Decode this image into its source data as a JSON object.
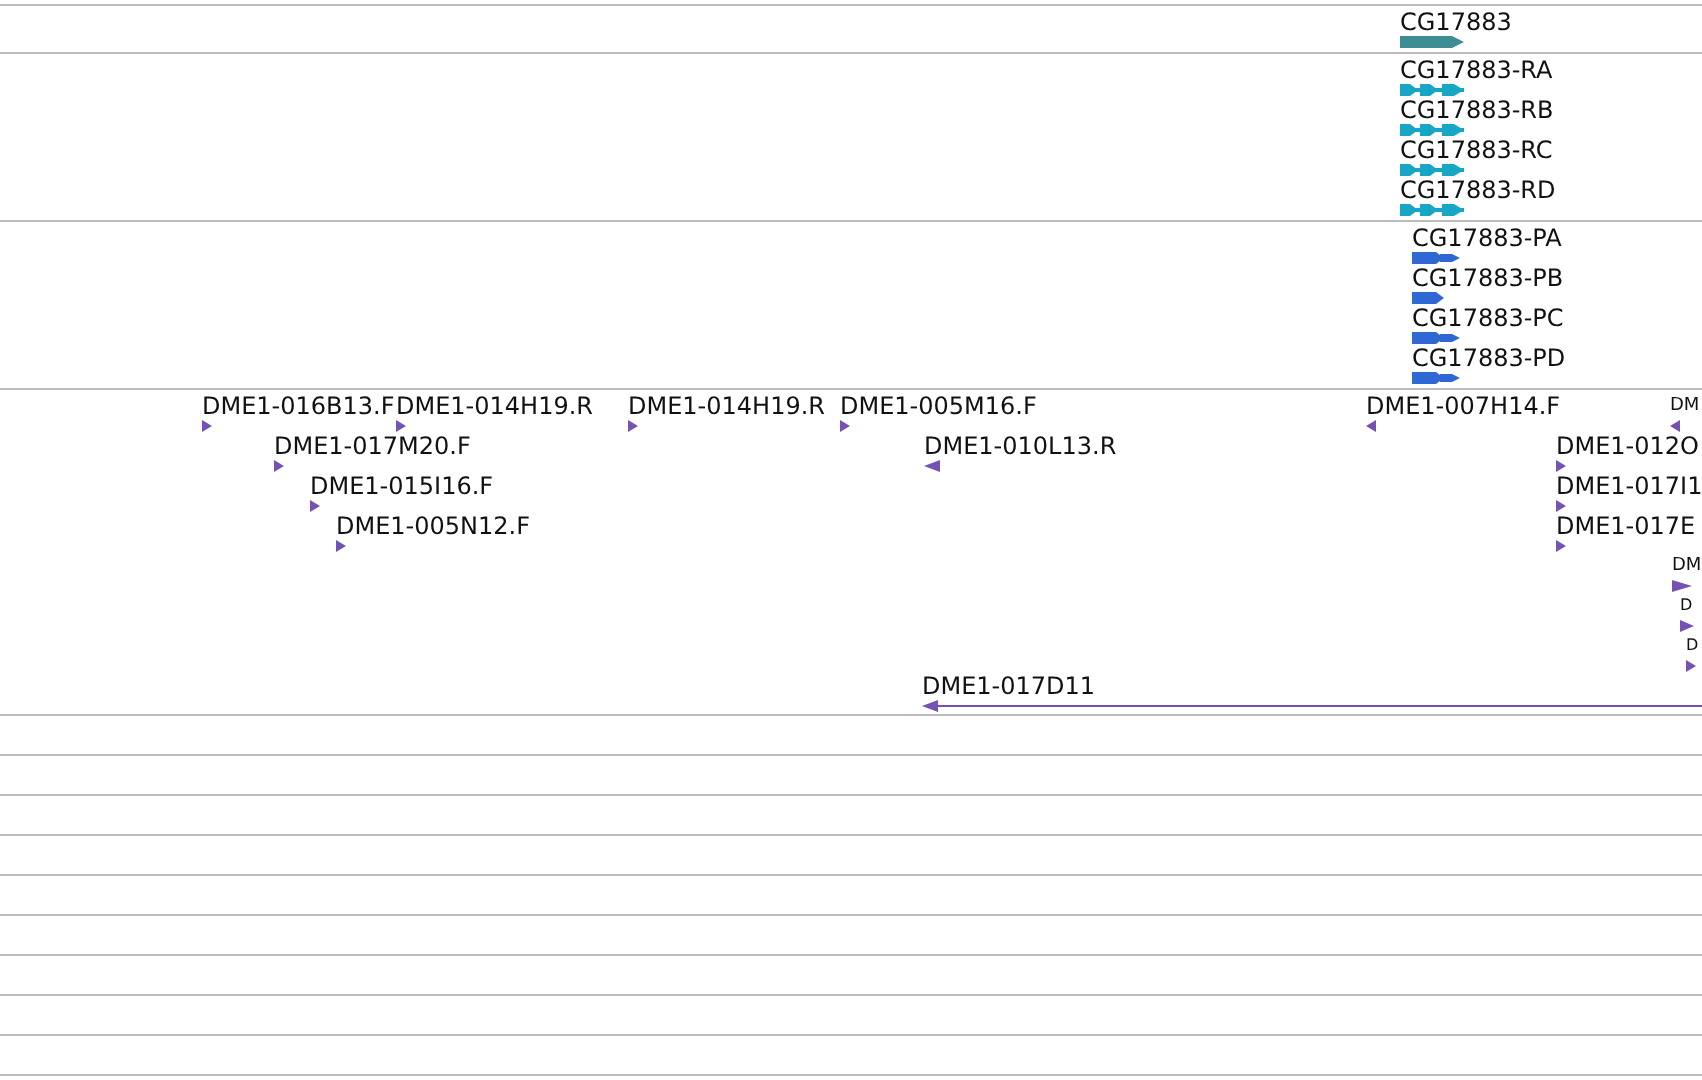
{
  "tracks": [
    {
      "features": [
        {
          "label": "CG17883",
          "kind": "gene",
          "reverse": false
        }
      ]
    },
    {
      "features": [
        {
          "label": "CG17883-RA",
          "kind": "transcript",
          "reverse": false
        },
        {
          "label": "CG17883-RB",
          "kind": "transcript",
          "reverse": false
        },
        {
          "label": "CG17883-RC",
          "kind": "transcript",
          "reverse": false
        },
        {
          "label": "CG17883-RD",
          "kind": "transcript",
          "reverse": false
        }
      ]
    },
    {
      "features": [
        {
          "label": "CG17883-PA",
          "kind": "protein",
          "reverse": false
        },
        {
          "label": "CG17883-PB",
          "kind": "protein",
          "reverse": false
        },
        {
          "label": "CG17883-PC",
          "kind": "protein",
          "reverse": false
        },
        {
          "label": "CG17883-PD",
          "kind": "protein",
          "reverse": false
        }
      ]
    },
    {
      "features": [
        {
          "label": "DME1-016B13.F",
          "kind": "clone",
          "reverse": false
        },
        {
          "label": "DME1-014H19.R",
          "kind": "clone",
          "reverse": false
        },
        {
          "label": "DME1-017M20.F",
          "kind": "clone",
          "reverse": false
        },
        {
          "label": "DME1-015I16.F",
          "kind": "clone",
          "reverse": false
        },
        {
          "label": "DME1-005N12.F",
          "kind": "clone",
          "reverse": false
        },
        {
          "label": "DME1-014H19.R",
          "kind": "clone",
          "reverse": false
        },
        {
          "label": "DME1-005M16.F",
          "kind": "clone",
          "reverse": false
        },
        {
          "label": "DME1-010L13.R",
          "kind": "clone",
          "reverse": true
        },
        {
          "label": "DME1-007H14.F",
          "kind": "clone",
          "reverse": true
        },
        {
          "label": "DM",
          "kind": "clone",
          "reverse": true
        },
        {
          "label": "DME1-012O",
          "kind": "clone",
          "reverse": false
        },
        {
          "label": "DME1-017I1",
          "kind": "clone",
          "reverse": false
        },
        {
          "label": "DME1-017E",
          "kind": "clone",
          "reverse": false
        },
        {
          "label": "DM",
          "kind": "clone",
          "reverse": false
        },
        {
          "label": "D",
          "kind": "clone",
          "reverse": false
        },
        {
          "label": "D",
          "kind": "clone",
          "reverse": false
        },
        {
          "label": "DME1-017D11",
          "kind": "clone",
          "reverse": true
        }
      ]
    }
  ]
}
